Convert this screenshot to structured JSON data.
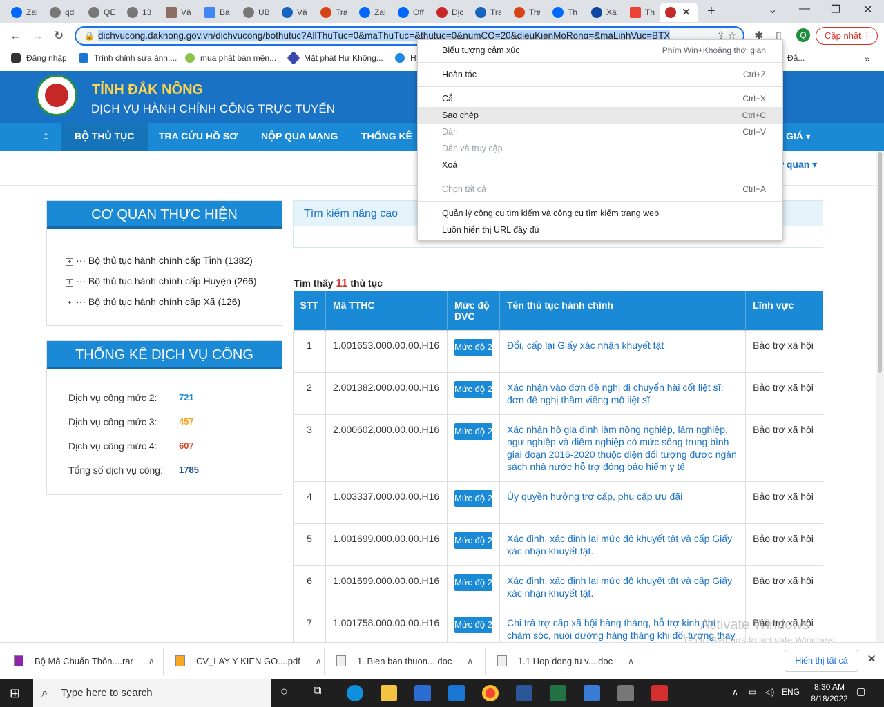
{
  "browser": {
    "tabs": [
      "Zal",
      "qd",
      "QE",
      "13",
      "Vă",
      "Ba",
      "UB",
      "Vă",
      "Tra",
      "Zal",
      "Off",
      "Dịc",
      "Tra",
      "Tra",
      "Th",
      "Xá",
      "Th",
      ""
    ],
    "active_tab_index": 17,
    "url": "dichvucong.daknong.gov.vn/dichvucong/bothutuc?AllThuTuc=0&maThuTuc=&thutuc=0&numCQ=20&dieuKienMoRong=&maLinhVuc=BTX",
    "profile_initial": "Q",
    "update_label": "Cập nhật"
  },
  "bookmarks": [
    "Đăng nhập",
    "Trình chỉnh sửa ảnh:...",
    "mua phát bản mện...",
    "Mặt phát Hư Không...",
    "H",
    "Đắ..."
  ],
  "header": {
    "title": "TỈNH ĐẮK NÔNG",
    "subtitle": "DỊCH VỤ HÀNH CHÍNH CÔNG TRỰC TUYẾN"
  },
  "nav": {
    "items": [
      "BỘ THỦ TỤC",
      "TRA CỨU HỒ SƠ",
      "NỘP QUA MẠNG",
      "THỐNG KÊ",
      "GIÁ"
    ],
    "right_link": "ơ quan"
  },
  "agency_panel": {
    "title": "CƠ QUAN THỰC HIỆN",
    "items": [
      "Bộ thủ tục hành chính cấp Tỉnh (1382)",
      "Bộ thủ tục hành chính cấp Huyện (266)",
      "Bộ thủ tục hành chính cấp Xã (126)"
    ]
  },
  "stats_panel": {
    "title": "THỐNG KÊ DỊCH VỤ CÔNG",
    "rows": [
      {
        "label": "Dịch vụ công mức 2:",
        "value": "721",
        "color": "#1a8ad6"
      },
      {
        "label": "Dịch vụ công mức 3:",
        "value": "457",
        "color": "#f5a623"
      },
      {
        "label": "Dịch vụ công mức 4:",
        "value": "607",
        "color": "#d0482a"
      },
      {
        "label": "Tổng số dịch vụ công:",
        "value": "1785",
        "color": "#1a4f8f"
      }
    ]
  },
  "search": {
    "title": "Tìm kiếm nâng cao"
  },
  "results": {
    "prefix": "Tìm thấy",
    "count": "11",
    "suffix": "thủ tục",
    "headers": [
      "STT",
      "Mã TTHC",
      "Mức độ DVC",
      "Tên thủ tục hành chính",
      "Lĩnh vực"
    ],
    "rows": [
      {
        "stt": "1",
        "code": "1.001653.000.00.00.H16",
        "level": "Mức độ 2",
        "name": "Đổi, cấp lại Giấy xác nhận khuyết tật",
        "field": "Bảo trợ xã hội"
      },
      {
        "stt": "2",
        "code": "2.001382.000.00.00.H16",
        "level": "Mức độ 2",
        "name": "Xác nhận vào đơn đề nghị di chuyển hài cốt liệt sĩ; đơn đề nghị thăm viếng mộ liệt sĩ",
        "field": "Bảo trợ xã hội"
      },
      {
        "stt": "3",
        "code": "2.000602.000.00.00.H16",
        "level": "Mức độ 2",
        "name": "Xác nhận hộ gia đình làm nông nghiệp, lâm nghiệp, ngư nghiệp và diêm nghiệp có mức sống trung bình giai đoạn 2016-2020 thuộc diện đối tượng được ngân sách nhà nước hỗ trợ đóng bảo hiểm y tế",
        "field": "Bảo trợ xã hội"
      },
      {
        "stt": "4",
        "code": "1.003337.000.00.00.H16",
        "level": "Mức độ 2",
        "name": "Ủy quyền hưởng trợ cấp, phụ cấp ưu đãi",
        "field": "Bảo trợ xã hội"
      },
      {
        "stt": "5",
        "code": "1.001699.000.00.00.H16",
        "level": "Mức độ 2",
        "name": "Xác định, xác định lại mức độ khuyết tật và cấp Giấy xác nhận khuyết tật.",
        "field": "Bảo trợ xã hội"
      },
      {
        "stt": "6",
        "code": "1.001699.000.00.00.H16",
        "level": "Mức độ 2",
        "name": "Xác định, xác định lại mức độ khuyết tật và cấp Giấy xác nhận khuyết tật.",
        "field": "Bảo trợ xã hội"
      },
      {
        "stt": "7",
        "code": "1.001758.000.00.00.H16",
        "level": "Mức độ 2",
        "name": "Chi trả trợ cấp xã hội hàng tháng, hỗ trợ kinh phí chăm sóc, nuôi dưỡng hàng tháng khi đối tượng thay",
        "field": "Bảo trợ xã hội"
      }
    ]
  },
  "context_menu": {
    "items": [
      {
        "label": "Biểu tượng cảm xúc",
        "shortcut": "Phím Win+Khoảng thời gian",
        "disabled": false
      },
      {
        "label": "Hoàn tác",
        "shortcut": "Ctrl+Z",
        "disabled": false
      },
      {
        "label": "Cắt",
        "shortcut": "Ctrl+X",
        "disabled": false
      },
      {
        "label": "Sao chép",
        "shortcut": "Ctrl+C",
        "disabled": false,
        "highlighted": true
      },
      {
        "label": "Dán",
        "shortcut": "Ctrl+V",
        "disabled": true
      },
      {
        "label": "Dán và truy cập",
        "shortcut": "",
        "disabled": true
      },
      {
        "label": "Xoá",
        "shortcut": "",
        "disabled": false
      },
      {
        "label": "Chọn tất cả",
        "shortcut": "Ctrl+A",
        "disabled": true
      },
      {
        "label": "Quản lý công cụ tìm kiếm và công cụ tìm kiếm trang web",
        "shortcut": "",
        "disabled": false
      },
      {
        "label": "Luôn hiển thị URL đầy đủ",
        "shortcut": "",
        "disabled": false
      }
    ]
  },
  "downloads": {
    "items": [
      "Bộ Mã Chuẩn Thôn....rar",
      "CV_LAY Y KIEN GO....pdf",
      "1. Bien ban thuon....doc",
      "1.1 Hop dong tu v....doc"
    ],
    "show_all": "Hiển thị tất cả"
  },
  "watermark": {
    "line1": "Activate Windows",
    "line2": "Go to Settings to activate Windows."
  },
  "taskbar": {
    "search_placeholder": "Type here to search",
    "lang": "ENG",
    "time": "8:30 AM",
    "date": "8/18/2022"
  }
}
